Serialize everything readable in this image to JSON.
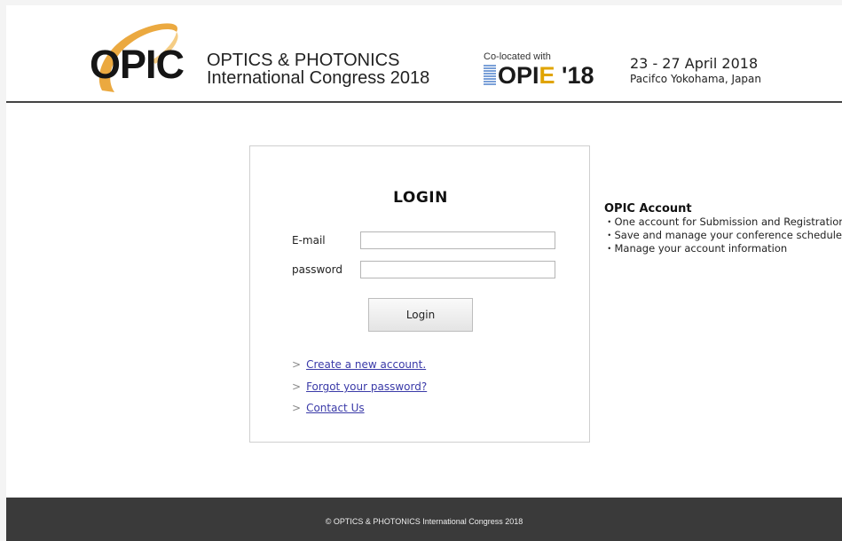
{
  "header": {
    "logo_text": "OPIC",
    "org_title_line1": "OPTICS & PHOTONICS",
    "org_title_line2": "International Congress 2018",
    "colocated_label": "Co-located with",
    "colocated_logo_part1": "OPI",
    "colocated_logo_part2": "E",
    "colocated_logo_part3": " '18",
    "event_dates": "23 - 27 April 2018",
    "event_venue": "Pacifco Yokohama, Japan"
  },
  "login": {
    "title": "LOGIN",
    "email_label": "E-mail",
    "email_value": "",
    "password_label": "password",
    "password_value": "",
    "button_label": "Login",
    "links": [
      {
        "arrow": ">",
        "label": "Create a new account."
      },
      {
        "arrow": ">",
        "label": "Forgot your password?"
      },
      {
        "arrow": ">",
        "label": "Contact Us"
      }
    ]
  },
  "account_info": {
    "title": "OPIC Account",
    "items": [
      "・One account for Submission and Registration",
      "・Save and manage your conference schedule",
      "・Manage your account information"
    ]
  },
  "footer": {
    "copyright": "© OPTICS & PHOTONICS International Congress 2018"
  },
  "colors": {
    "footer_bg": "#3a3a3a",
    "logo_orange": "#e89a1e",
    "link": "#3a3aa8",
    "opie_e": "#e0a400"
  }
}
